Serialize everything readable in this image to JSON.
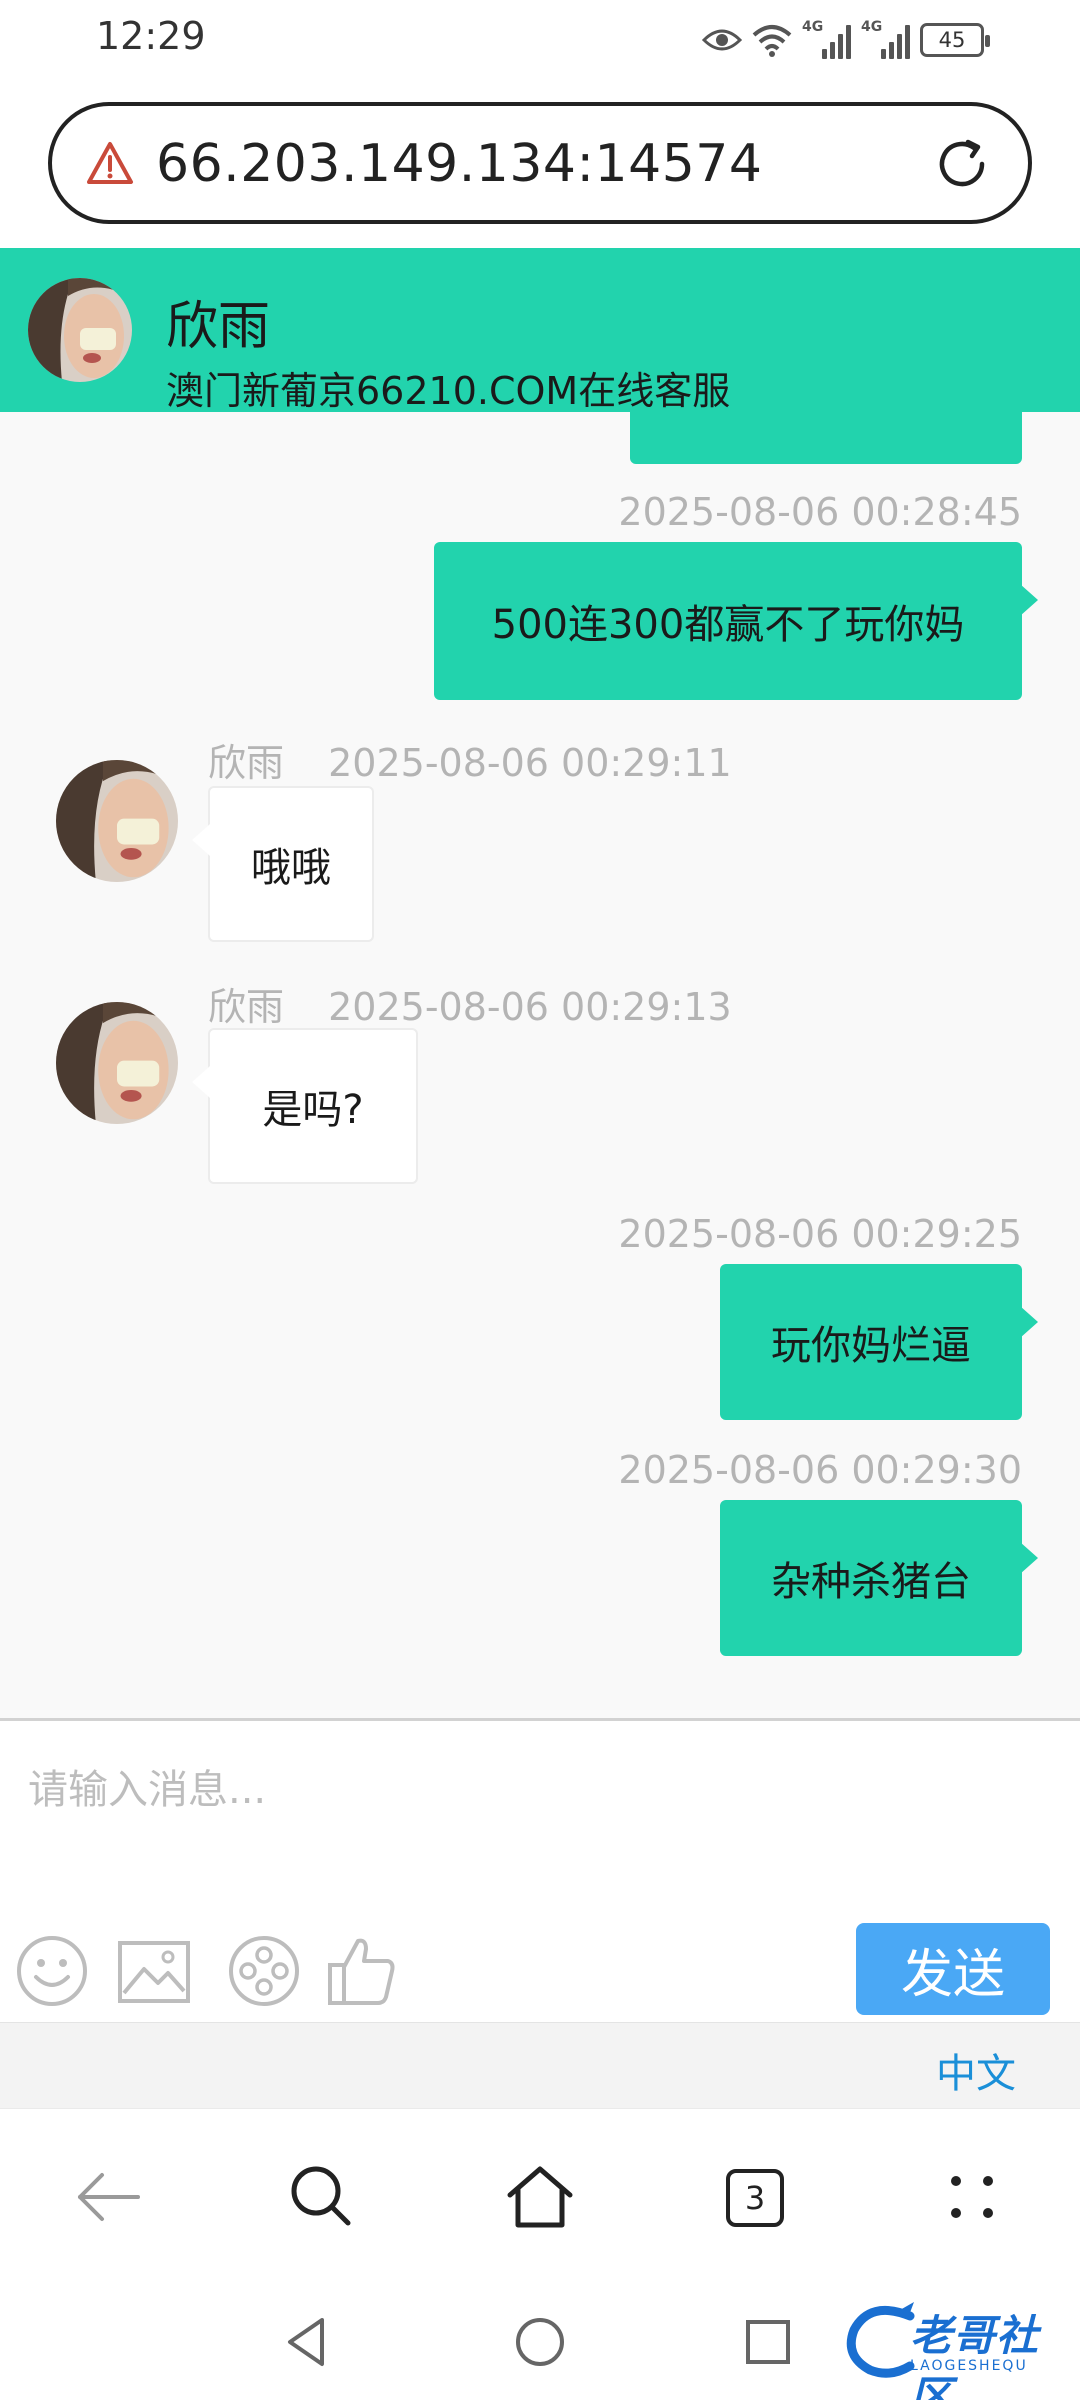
{
  "status_bar": {
    "time": "12:29",
    "network_1": "4G",
    "network_2": "4G",
    "battery": "45"
  },
  "browser": {
    "url": "66.203.149.134:14574",
    "tab_count": "3"
  },
  "chat_header": {
    "agent_name": "欣雨",
    "subtitle": "澳门新葡京66210.COM在线客服",
    "background_color": "#22d3ad"
  },
  "messages": [
    {
      "direction": "outgoing",
      "timestamp": "2025-08-06 00:28:45",
      "text": "500连300都赢不了玩你妈"
    },
    {
      "direction": "incoming",
      "sender": "欣雨",
      "timestamp": "2025-08-06 00:29:11",
      "text": "哦哦"
    },
    {
      "direction": "incoming",
      "sender": "欣雨",
      "timestamp": "2025-08-06 00:29:13",
      "text": "是吗?"
    },
    {
      "direction": "outgoing",
      "timestamp": "2025-08-06 00:29:25",
      "text": "玩你妈烂逼"
    },
    {
      "direction": "outgoing",
      "timestamp": "2025-08-06 00:29:30",
      "text": "杂种杀猪台"
    }
  ],
  "composer": {
    "placeholder": "请输入消息...",
    "send_label": "发送",
    "tools": [
      "emoji-icon",
      "image-icon",
      "video-icon",
      "thumbs-up-icon"
    ],
    "send_color": "#4aa8f5"
  },
  "language": {
    "label": "中文"
  },
  "watermark": {
    "text": "老哥社区",
    "sub": "LAOGESHEQU"
  }
}
